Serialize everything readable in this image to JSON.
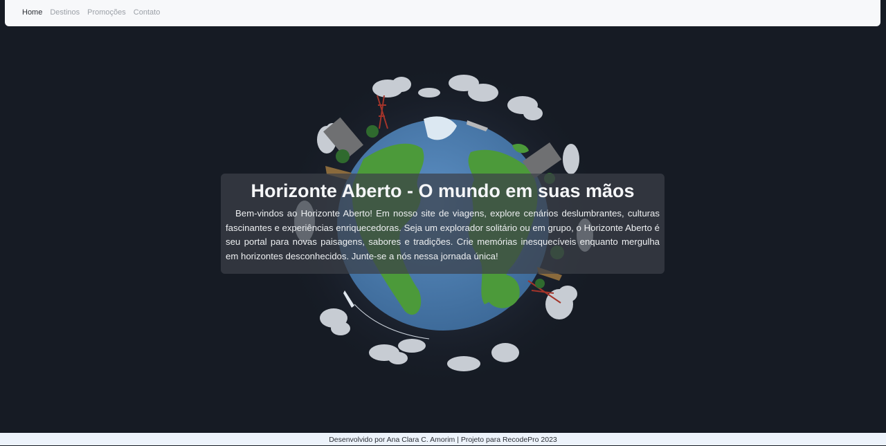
{
  "nav": {
    "items": [
      {
        "label": "Home",
        "active": true
      },
      {
        "label": "Destinos",
        "active": false
      },
      {
        "label": "Promoções",
        "active": false
      },
      {
        "label": "Contato",
        "active": false
      }
    ]
  },
  "hero": {
    "title": "Horizonte Aberto - O mundo em suas mãos",
    "text": "Bem-vindos ao Horizonte Aberto! Em nosso site de viagens, explore cenários deslumbrantes, culturas fascinantes e experiências enriquecedoras. Seja um explorador solitário ou em grupo, o Horizonte Aberto é seu portal para novas paisagens, sabores e tradições. Crie memórias inesquecíveis enquanto mergulha em horizontes desconhecidos. Junte-se a nós nessa jornada única!"
  },
  "footer": {
    "text": "Desenvolvido por Ana Clara C. Amorim | Projeto para RecodePro 2023"
  },
  "colors": {
    "background": "#161b24",
    "ocean": "#4f7fb0",
    "land": "#4c9a3a",
    "navbar": "#f7f8fa",
    "footer": "#edf3fb"
  },
  "icons": [
    "globe-illustration",
    "cloud-icon",
    "building-icon",
    "tower-icon",
    "airplane-icon",
    "ship-icon",
    "tree-icon"
  ]
}
